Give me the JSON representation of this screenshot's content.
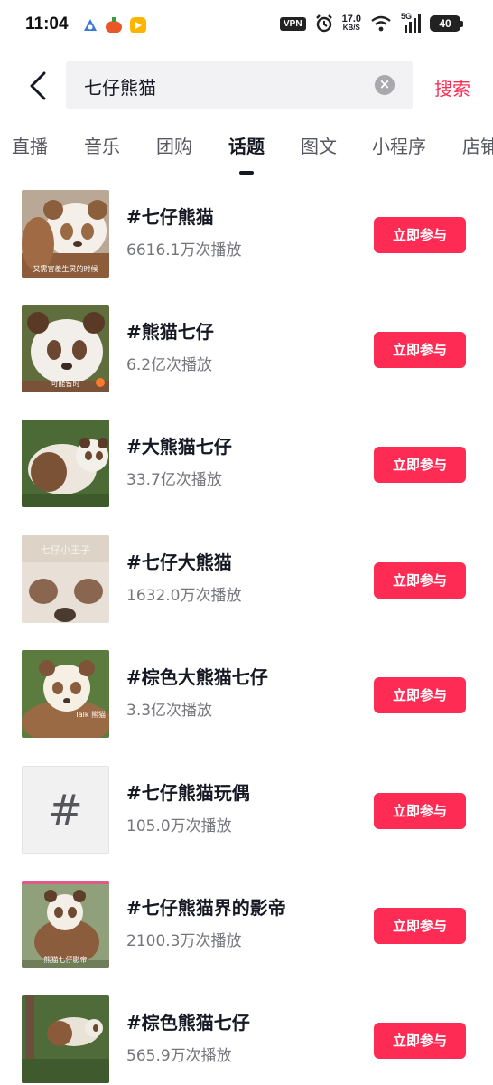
{
  "status_bar": {
    "time": "11:04",
    "vpn": "VPN",
    "net_speed": "17.0",
    "net_unit": "KB/S",
    "signal": "5G",
    "battery": "40"
  },
  "search": {
    "query": "七仔熊猫",
    "submit_label": "搜索"
  },
  "tabs": [
    {
      "label": "直播"
    },
    {
      "label": "音乐"
    },
    {
      "label": "团购"
    },
    {
      "label": "话题",
      "active": true
    },
    {
      "label": "图文"
    },
    {
      "label": "小程序"
    },
    {
      "label": "店铺"
    }
  ],
  "topics": [
    {
      "title": "#七仔熊猫",
      "plays": "6616.1万次播放",
      "thumb_caption": "又需害羞生灵的时候",
      "button": "立即参与"
    },
    {
      "title": "#熊猫七仔",
      "plays": "6.2亿次播放",
      "thumb_caption": "可能暂时",
      "button": "立即参与"
    },
    {
      "title": "#大熊猫七仔",
      "plays": "33.7亿次播放",
      "thumb_caption": "",
      "button": "立即参与"
    },
    {
      "title": "#七仔大熊猫",
      "plays": "1632.0万次播放",
      "thumb_caption": "七仔小王子",
      "button": "立即参与"
    },
    {
      "title": "#棕色大熊猫七仔",
      "plays": "3.3亿次播放",
      "thumb_caption": "Talk 熊猫",
      "button": "立即参与"
    },
    {
      "title": "#七仔熊猫玩偶",
      "plays": "105.0万次播放",
      "thumb_caption": "#",
      "button": "立即参与"
    },
    {
      "title": "#七仔熊猫界的影帝",
      "plays": "2100.3万次播放",
      "thumb_caption": "熊猫七仔影帝",
      "button": "立即参与"
    },
    {
      "title": "#棕色熊猫七仔",
      "plays": "565.9万次播放",
      "thumb_caption": "",
      "button": "立即参与"
    }
  ],
  "colors": {
    "accent": "#fe2c55",
    "text_primary": "#161823",
    "text_secondary": "#75767c"
  }
}
